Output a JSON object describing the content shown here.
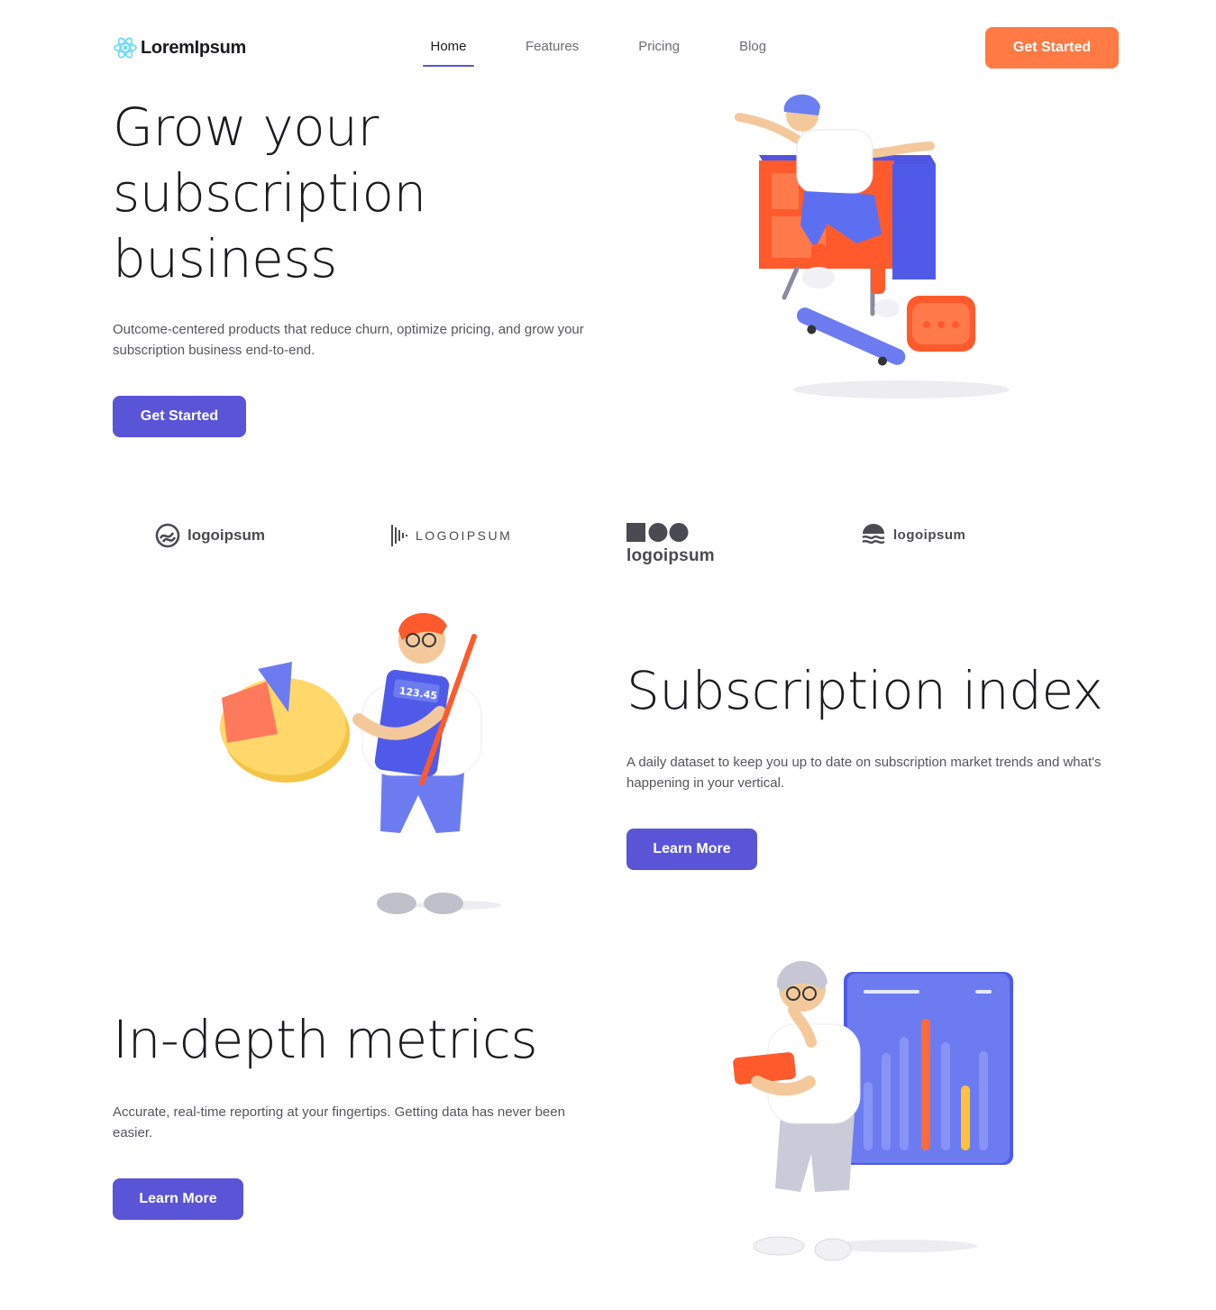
{
  "brand": {
    "name": "LoremIpsum",
    "icon": "atom-icon"
  },
  "nav": {
    "links": [
      {
        "label": "Home",
        "active": true
      },
      {
        "label": "Features"
      },
      {
        "label": "Pricing"
      },
      {
        "label": "Blog"
      }
    ],
    "cta_label": "Get Started"
  },
  "hero": {
    "title_lines": [
      "Grow your",
      "subscription",
      "business"
    ],
    "description": "Outcome-centered products that reduce churn, optimize pricing, and grow your subscription business end-to-end.",
    "button_label": "Get Started",
    "illustration": "skateboarder-illustration"
  },
  "logos": [
    {
      "text": "logoipsum",
      "icon": "circle-waves-icon"
    },
    {
      "text": "LOGOIPSUM",
      "icon": "sound-bars-icon"
    },
    {
      "text": "logoipsum",
      "icon": "square-circles-icon"
    },
    {
      "text": "logoipsum",
      "icon": "wave-dome-icon"
    }
  ],
  "section_index": {
    "title": "Subscription index",
    "description": "A daily dataset to keep you up to date on subscription market trends and what's happening in your vertical.",
    "button_label": "Learn More",
    "illustration": "calculator-person-illustration",
    "calculator_display": "123.45"
  },
  "section_metrics": {
    "title": "In-depth metrics",
    "description": "Accurate, real-time reporting at your fingertips. Getting data has never been easier.",
    "button_label": "Learn More",
    "illustration": "chart-board-person-illustration"
  },
  "colors": {
    "primary": "#5a54d6",
    "accent": "#ff7a45",
    "text": "#1b1b1f",
    "muted": "#55555e"
  }
}
